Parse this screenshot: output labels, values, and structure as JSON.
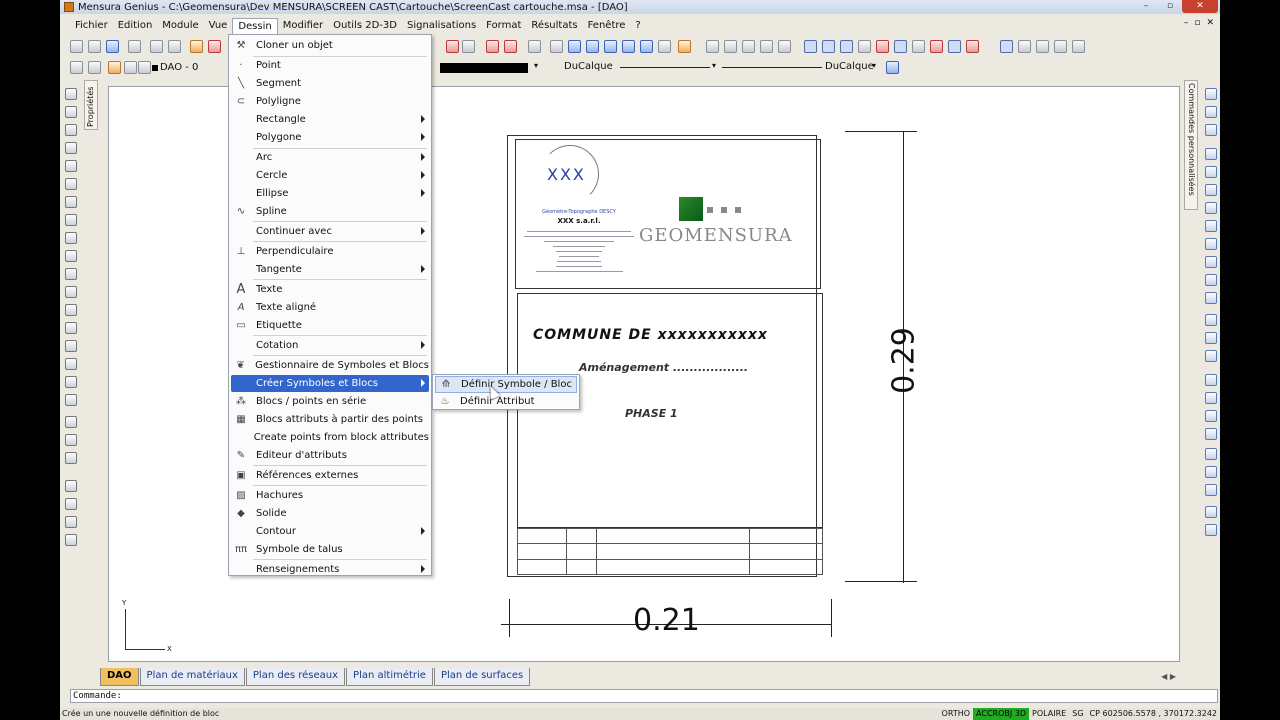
{
  "window": {
    "title": "Mensura Genius - C:\\Geomensura\\Dev MENSURA\\SCREEN CAST\\Cartouche\\ScreenCast cartouche.msa - [DAO]",
    "controls": [
      "–",
      "▫",
      "✕"
    ]
  },
  "menubar": {
    "items": [
      "Fichier",
      "Edition",
      "Module",
      "Vue",
      "Dessin",
      "Modifier",
      "Outils 2D-3D",
      "Signalisations",
      "Format",
      "Résultats",
      "Fenêtre",
      "?"
    ],
    "active": "Dessin"
  },
  "toolbar2": {
    "layer": "DAO - 0",
    "linetype": "DuCalque",
    "lineweight": "DuCalque"
  },
  "side_tabs": {
    "properties": "Propriétés",
    "commands": "Commandes personnalisées"
  },
  "dessin_menu": {
    "items": [
      {
        "label": "Cloner un objet",
        "icon": "clone-icon",
        "glyph": "⚒"
      },
      {
        "label": "Point",
        "icon": "point-icon",
        "glyph": "·"
      },
      {
        "label": "Segment",
        "icon": "segment-icon",
        "glyph": "╲"
      },
      {
        "label": "Polyligne",
        "icon": "polyline-icon",
        "glyph": "⊂"
      },
      {
        "label": "Rectangle",
        "icon": "",
        "glyph": "",
        "submenu": true
      },
      {
        "label": "Polygone",
        "icon": "",
        "glyph": "",
        "submenu": true
      },
      {
        "label": "Arc",
        "icon": "",
        "glyph": "",
        "submenu": true
      },
      {
        "label": "Cercle",
        "icon": "",
        "glyph": "",
        "submenu": true
      },
      {
        "label": "Ellipse",
        "icon": "",
        "glyph": "",
        "submenu": true
      },
      {
        "label": "Spline",
        "icon": "spline-icon",
        "glyph": "∿"
      },
      {
        "label": "Continuer avec",
        "icon": "",
        "glyph": "",
        "submenu": true
      },
      {
        "label": "Perpendiculaire",
        "icon": "perpendicular-icon",
        "glyph": "⊥"
      },
      {
        "label": "Tangente",
        "icon": "",
        "glyph": "",
        "submenu": true
      },
      {
        "label": "Texte",
        "icon": "text-icon",
        "glyph": "A"
      },
      {
        "label": "Texte aligné",
        "icon": "aligned-text-icon",
        "glyph": "A"
      },
      {
        "label": "Etiquette",
        "icon": "label-icon",
        "glyph": "▭"
      },
      {
        "label": "Cotation",
        "icon": "",
        "glyph": "",
        "submenu": true
      },
      {
        "label": "Gestionnaire de Symboles et Blocs",
        "icon": "symbol-manager-icon",
        "glyph": "❦"
      },
      {
        "label": "Créer Symboles et Blocs",
        "icon": "",
        "glyph": "",
        "submenu": true
      },
      {
        "label": "Blocs / points en série",
        "icon": "series-blocks-icon",
        "glyph": "⁂"
      },
      {
        "label": "Blocs attributs à partir des points",
        "icon": "attribute-blocks-icon",
        "glyph": "▦"
      },
      {
        "label": "Create points from block attributes",
        "icon": "",
        "glyph": ""
      },
      {
        "label": "Editeur d'attributs",
        "icon": "attribute-editor-icon",
        "glyph": "✎"
      },
      {
        "label": "Références externes",
        "icon": "xref-icon",
        "glyph": "▣"
      },
      {
        "label": "Hachures",
        "icon": "hatch-icon",
        "glyph": "▨"
      },
      {
        "label": "Solide",
        "icon": "solid-icon",
        "glyph": "◆"
      },
      {
        "label": "Contour",
        "icon": "",
        "glyph": "",
        "submenu": true
      },
      {
        "label": "Symbole de talus",
        "icon": "slope-symbol-icon",
        "glyph": "ππ"
      },
      {
        "label": "Renseignements",
        "icon": "",
        "glyph": "",
        "submenu": true
      }
    ],
    "highlighted": "Créer Symboles et Blocs"
  },
  "submenu": {
    "items": [
      {
        "label": "Définir Symbole / Bloc",
        "icon": "define-block-icon",
        "glyph": "⟰"
      },
      {
        "label": "Définir Attribut",
        "icon": "define-attribute-icon",
        "glyph": "♨"
      }
    ]
  },
  "drawing": {
    "logo_text": "XXX",
    "company_tagline": "Géomètre-Topographe DESCY",
    "company_name": "XXX s.a.r.l.",
    "brand": "GEOMENSURA",
    "commune": "COMMUNE  DE  xxxxxxxxxxx",
    "amenagement": "Aménagement ..................",
    "phase": "PHASE 1",
    "dim_height": "0.29",
    "dim_width": "0.21",
    "ucs_x": "X",
    "ucs_y": "Y"
  },
  "tabs": {
    "items": [
      "DAO",
      "Plan de matériaux",
      "Plan des réseaux",
      "Plan altimétrie",
      "Plan de surfaces"
    ],
    "active": "DAO"
  },
  "cmdline": {
    "label": "Commande:"
  },
  "status": {
    "message": "Crée un une nouvelle définition de bloc",
    "ortho": "ORTHO",
    "accrobj": "ACCROBJ 3D",
    "polaire": "POLAIRE",
    "sg": "SG",
    "coords": "CP 602506.5578 , 370172.3242"
  }
}
